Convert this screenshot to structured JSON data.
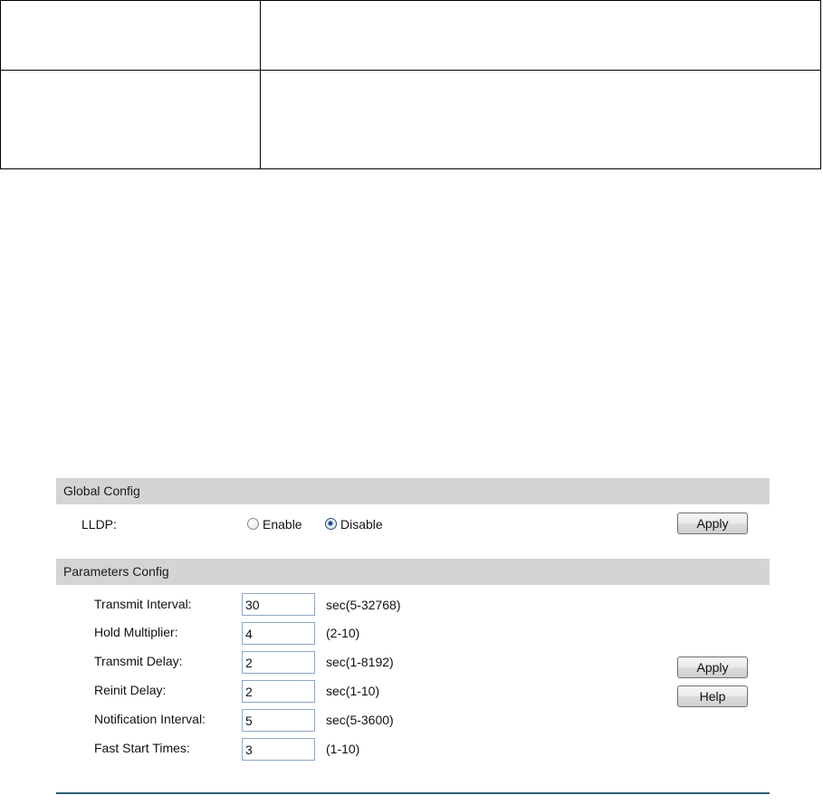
{
  "global_config": {
    "header": "Global Config",
    "lldp_label": "LLDP:",
    "enable_label": "Enable",
    "disable_label": "Disable",
    "selected": "Disable",
    "apply_label": "Apply"
  },
  "parameters_config": {
    "header": "Parameters Config",
    "fields": [
      {
        "label": "Transmit Interval:",
        "value": "30",
        "hint": "sec(5-32768)"
      },
      {
        "label": "Hold Multiplier:",
        "value": "4",
        "hint": "(2-10)"
      },
      {
        "label": "Transmit Delay:",
        "value": "2",
        "hint": "sec(1-8192)"
      },
      {
        "label": "Reinit Delay:",
        "value": "2",
        "hint": "sec(1-10)"
      },
      {
        "label": "Notification Interval:",
        "value": "5",
        "hint": "sec(5-3600)"
      },
      {
        "label": "Fast Start Times:",
        "value": "3",
        "hint": "(1-10)"
      }
    ],
    "apply_label": "Apply",
    "help_label": "Help"
  }
}
